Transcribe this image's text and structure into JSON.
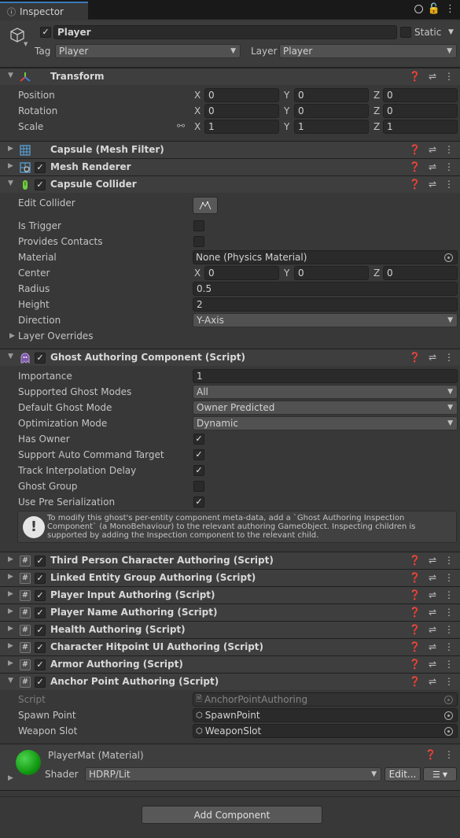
{
  "tab": {
    "title": "Inspector"
  },
  "object": {
    "name": "Player",
    "static_label": "Static",
    "tag_label": "Tag",
    "tag_value": "Player",
    "layer_label": "Layer",
    "layer_value": "Player"
  },
  "transform": {
    "title": "Transform",
    "position_label": "Position",
    "rotation_label": "Rotation",
    "scale_label": "Scale",
    "axes": [
      "X",
      "Y",
      "Z"
    ],
    "position": [
      "0",
      "0",
      "0"
    ],
    "rotation": [
      "0",
      "0",
      "0"
    ],
    "scale": [
      "1",
      "1",
      "1"
    ]
  },
  "components": {
    "mesh_filter": "Capsule (Mesh Filter)",
    "mesh_renderer": "Mesh Renderer",
    "capsule_collider": "Capsule Collider",
    "ghost_authoring": "Ghost Authoring Component (Script)",
    "third_person": "Third Person Character Authoring (Script)",
    "linked_entity": "Linked Entity Group Authoring (Script)",
    "player_input": "Player Input Authoring (Script)",
    "player_name": "Player Name Authoring (Script)",
    "health": "Health Authoring (Script)",
    "hitpoint_ui": "Character Hitpoint UI Authoring (Script)",
    "armor": "Armor Authoring (Script)",
    "anchor_point": "Anchor Point Authoring (Script)"
  },
  "collider": {
    "edit_label": "Edit Collider",
    "is_trigger_label": "Is Trigger",
    "provides_contacts_label": "Provides Contacts",
    "material_label": "Material",
    "material_value": "None (Physics Material)",
    "center_label": "Center",
    "center": [
      "0",
      "0",
      "0"
    ],
    "radius_label": "Radius",
    "radius_value": "0.5",
    "height_label": "Height",
    "height_value": "2",
    "direction_label": "Direction",
    "direction_value": "Y-Axis",
    "layer_overrides_label": "Layer Overrides"
  },
  "ghost": {
    "importance_label": "Importance",
    "importance_value": "1",
    "supported_modes_label": "Supported Ghost Modes",
    "supported_modes_value": "All",
    "default_mode_label": "Default Ghost Mode",
    "default_mode_value": "Owner Predicted",
    "optimization_label": "Optimization Mode",
    "optimization_value": "Dynamic",
    "has_owner_label": "Has Owner",
    "auto_command_label": "Support Auto Command Target",
    "track_interp_label": "Track Interpolation Delay",
    "ghost_group_label": "Ghost Group",
    "pre_serialization_label": "Use Pre Serialization",
    "help_text": "To modify this ghost's per-entity component meta-data, add a `Ghost Authoring Inspection Component` (a MonoBehaviour) to the relevant authoring GameObject. Inspecting children is supported by adding the Inspection component to the relevant child."
  },
  "anchor": {
    "script_label": "Script",
    "script_value": "AnchorPointAuthoring",
    "spawn_label": "Spawn Point",
    "spawn_value": "SpawnPoint",
    "weapon_label": "Weapon Slot",
    "weapon_value": "WeaponSlot"
  },
  "material": {
    "title": "PlayerMat (Material)",
    "shader_label": "Shader",
    "shader_value": "HDRP/Lit",
    "edit_button": "Edit..."
  },
  "add_component": "Add Component"
}
